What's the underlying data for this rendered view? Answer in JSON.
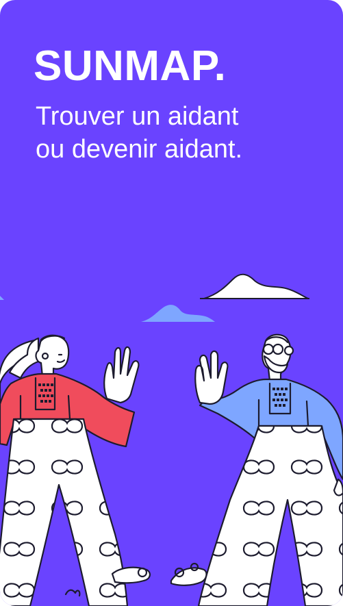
{
  "app": {
    "brand": "SUNMAP.",
    "tagline": {
      "line1": "Trouver un aidant",
      "line2": "ou devenir aidant."
    }
  },
  "colors": {
    "background": "#6a43ff",
    "text": "#ffffff",
    "cloud_light": "#ffffff",
    "cloud_blue": "#7ea6ff",
    "woman_shirt": "#f04c5c",
    "man_shirt": "#7ea6ff",
    "outline": "#1c1b2e"
  },
  "illustration": {
    "name": "two-people-waving-illustration",
    "elements": [
      "cloud-icon",
      "cloud-icon",
      "woman-waving-figure",
      "man-waving-figure"
    ]
  }
}
